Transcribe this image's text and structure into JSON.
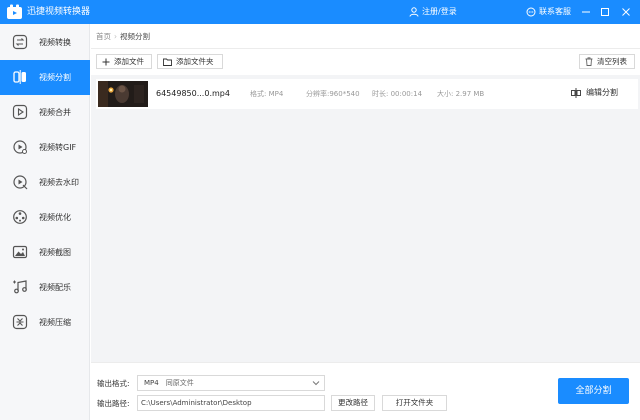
{
  "app": {
    "title": "迅捷视频转换器",
    "accent": "#1a8cff"
  },
  "header": {
    "login": "注册/登录",
    "support": "联系客服"
  },
  "sidebar": {
    "items": [
      {
        "label": "视频转换",
        "icon": "video-convert-icon"
      },
      {
        "label": "视频分割",
        "icon": "video-split-icon",
        "active": true
      },
      {
        "label": "视频合并",
        "icon": "video-merge-icon"
      },
      {
        "label": "视频转GIF",
        "icon": "video-to-gif-icon"
      },
      {
        "label": "视频去水印",
        "icon": "remove-watermark-icon"
      },
      {
        "label": "视频优化",
        "icon": "video-optimize-icon"
      },
      {
        "label": "视频截图",
        "icon": "video-screenshot-icon"
      },
      {
        "label": "视频配乐",
        "icon": "video-music-icon"
      },
      {
        "label": "视频压缩",
        "icon": "video-compress-icon"
      }
    ]
  },
  "breadcrumb": {
    "home": "首页",
    "current": "视频分割"
  },
  "toolbar": {
    "add_file": "添加文件",
    "add_folder": "添加文件夹",
    "clear_list": "清空列表"
  },
  "file": {
    "name": "64549850...0.mp4",
    "format": "格式: MP4",
    "resolution": "分辨率:960*540",
    "duration": "时长: 00:00:14",
    "size": "大小: 2.97 MB",
    "action": "编辑分割"
  },
  "output": {
    "format_label": "输出格式:",
    "format_value": "MP4",
    "format_sub": "同原文件",
    "path_label": "输出路径:",
    "path_value": "C:\\Users\\Administrator\\Desktop",
    "change_path": "更改路径",
    "open_folder": "打开文件夹"
  },
  "primary_action": "全部分割"
}
